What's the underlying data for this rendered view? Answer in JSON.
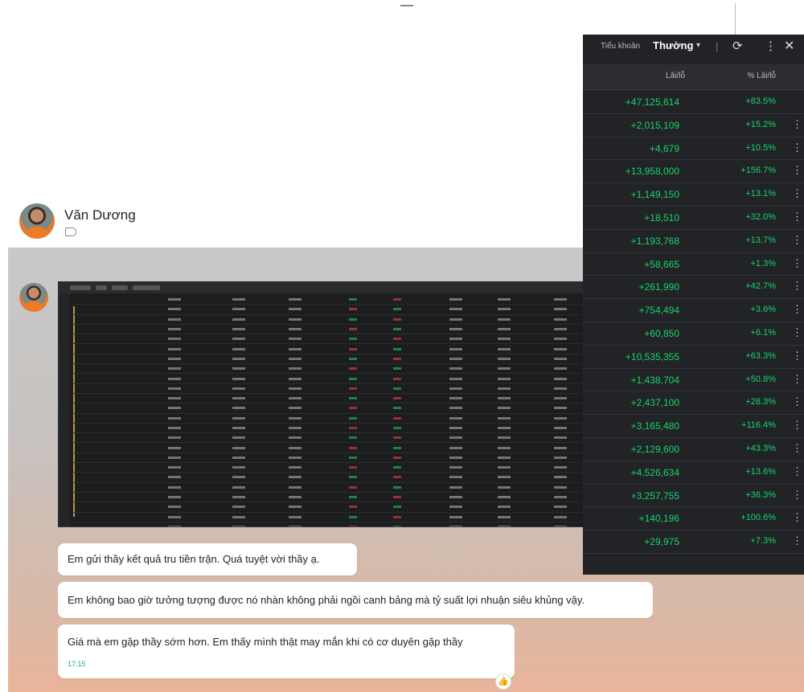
{
  "sender": {
    "name": "Văn Dương"
  },
  "messages": [
    {
      "text": "Em gửi thầy kết quả tru tiền trận. Quá tuyệt vời thầy ạ."
    },
    {
      "text": "Em không bao giờ tưởng tượng được nó nhàn không phải ngồi canh bảng mà tỷ suất lợi nhuận siêu khủng vậy."
    },
    {
      "text": "Giá mà em gặp thầy sớm hơn. Em thấy mình thật may mắn khi có cơ duyên gặp thầy",
      "time": "17:15"
    }
  ],
  "reaction_icon": "thumbs-up-icon",
  "pnl_panel": {
    "account_label": "Tiểu khoản",
    "account_value": "Thường",
    "columns": [
      "Lãi/lỗ",
      "% Lãi/lỗ"
    ],
    "rows": [
      {
        "pnl": "+47,125,614",
        "pct": "+83.5%"
      },
      {
        "pnl": "+2,015,109",
        "pct": "+15.2%"
      },
      {
        "pnl": "+4,679",
        "pct": "+10.5%"
      },
      {
        "pnl": "+13,958,000",
        "pct": "+156.7%"
      },
      {
        "pnl": "+1,149,150",
        "pct": "+13.1%"
      },
      {
        "pnl": "+18,510",
        "pct": "+32.0%"
      },
      {
        "pnl": "+1,193,768",
        "pct": "+13.7%"
      },
      {
        "pnl": "+58,665",
        "pct": "+1.3%"
      },
      {
        "pnl": "+261,990",
        "pct": "+42.7%"
      },
      {
        "pnl": "+754,494",
        "pct": "+3.6%"
      },
      {
        "pnl": "+60,850",
        "pct": "+6.1%"
      },
      {
        "pnl": "+10,535,355",
        "pct": "+63.3%"
      },
      {
        "pnl": "+1,438,704",
        "pct": "+50.8%"
      },
      {
        "pnl": "+2,437,100",
        "pct": "+28.3%"
      },
      {
        "pnl": "+3,165,480",
        "pct": "+116.4%"
      },
      {
        "pnl": "+2,129,600",
        "pct": "+43.3%"
      },
      {
        "pnl": "+4,526,634",
        "pct": "+13.6%"
      },
      {
        "pnl": "+3,257,755",
        "pct": "+36.3%"
      },
      {
        "pnl": "+140,196",
        "pct": "+100.6%"
      },
      {
        "pnl": "+29,975",
        "pct": "+7.3%"
      }
    ],
    "positive_color": "#17d46c"
  }
}
